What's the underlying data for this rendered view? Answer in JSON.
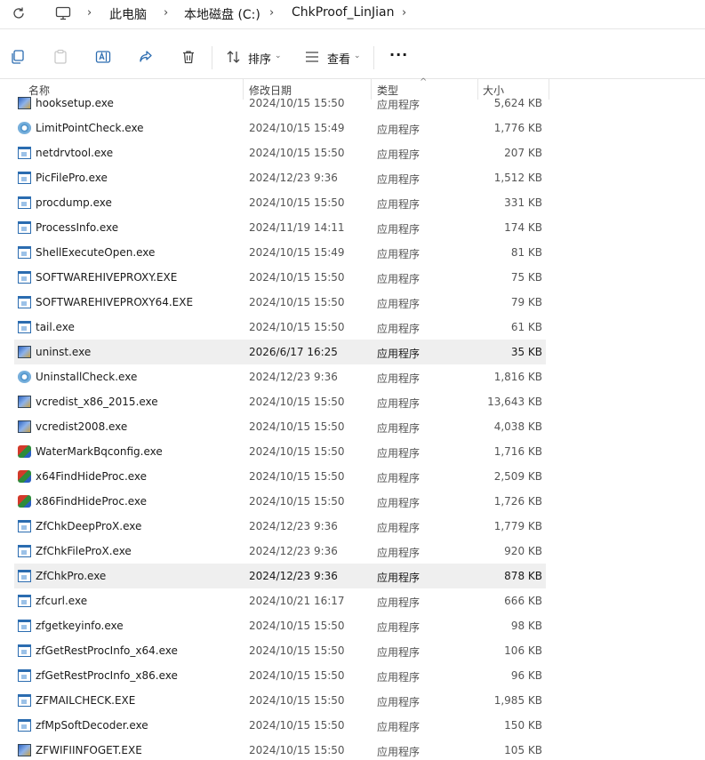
{
  "breadcrumb": {
    "items": [
      "此电脑",
      "本地磁盘 (C:)",
      "ChkProof_LinJian"
    ]
  },
  "toolbar": {
    "sort_label": "排序",
    "view_label": "查看",
    "more_label": "···"
  },
  "columns": {
    "name": "名称",
    "date": "修改日期",
    "type": "类型",
    "size": "大小"
  },
  "files": [
    {
      "name": "hooksetup.exe",
      "date": "2024/10/15 15:50",
      "type": "应用程序",
      "size": "5,624 KB",
      "icon": "installer-icon"
    },
    {
      "name": "LimitPointCheck.exe",
      "date": "2024/10/15 15:49",
      "type": "应用程序",
      "size": "1,776 KB",
      "icon": "disc-icon"
    },
    {
      "name": "netdrvtool.exe",
      "date": "2024/10/15 15:50",
      "type": "应用程序",
      "size": "207 KB",
      "icon": "app-window-icon"
    },
    {
      "name": "PicFilePro.exe",
      "date": "2024/12/23 9:36",
      "type": "应用程序",
      "size": "1,512 KB",
      "icon": "app-window-icon"
    },
    {
      "name": "procdump.exe",
      "date": "2024/10/15 15:50",
      "type": "应用程序",
      "size": "331 KB",
      "icon": "app-window-icon"
    },
    {
      "name": "ProcessInfo.exe",
      "date": "2024/11/19 14:11",
      "type": "应用程序",
      "size": "174 KB",
      "icon": "app-window-icon"
    },
    {
      "name": "ShellExecuteOpen.exe",
      "date": "2024/10/15 15:49",
      "type": "应用程序",
      "size": "81 KB",
      "icon": "app-window-icon"
    },
    {
      "name": "SOFTWAREHIVEPROXY.EXE",
      "date": "2024/10/15 15:50",
      "type": "应用程序",
      "size": "75 KB",
      "icon": "app-window-icon"
    },
    {
      "name": "SOFTWAREHIVEPROXY64.EXE",
      "date": "2024/10/15 15:50",
      "type": "应用程序",
      "size": "79 KB",
      "icon": "app-window-icon"
    },
    {
      "name": "tail.exe",
      "date": "2024/10/15 15:50",
      "type": "应用程序",
      "size": "61 KB",
      "icon": "app-window-icon"
    },
    {
      "name": "uninst.exe",
      "date": "2026/6/17 16:25",
      "type": "应用程序",
      "size": "35 KB",
      "icon": "installer-icon",
      "highlighted": true
    },
    {
      "name": "UninstallCheck.exe",
      "date": "2024/12/23 9:36",
      "type": "应用程序",
      "size": "1,816 KB",
      "icon": "disc-icon"
    },
    {
      "name": "vcredist_x86_2015.exe",
      "date": "2024/10/15 15:50",
      "type": "应用程序",
      "size": "13,643 KB",
      "icon": "installer-icon"
    },
    {
      "name": "vcredist2008.exe",
      "date": "2024/10/15 15:50",
      "type": "应用程序",
      "size": "4,038 KB",
      "icon": "installer-icon"
    },
    {
      "name": "WaterMarkBqconfig.exe",
      "date": "2024/10/15 15:50",
      "type": "应用程序",
      "size": "1,716 KB",
      "icon": "puzzle-icon"
    },
    {
      "name": "x64FindHideProc.exe",
      "date": "2024/10/15 15:50",
      "type": "应用程序",
      "size": "2,509 KB",
      "icon": "puzzle-icon"
    },
    {
      "name": "x86FindHideProc.exe",
      "date": "2024/10/15 15:50",
      "type": "应用程序",
      "size": "1,726 KB",
      "icon": "puzzle-icon"
    },
    {
      "name": "ZfChkDeepProX.exe",
      "date": "2024/12/23 9:36",
      "type": "应用程序",
      "size": "1,779 KB",
      "icon": "app-window-icon"
    },
    {
      "name": "ZfChkFileProX.exe",
      "date": "2024/12/23 9:36",
      "type": "应用程序",
      "size": "920 KB",
      "icon": "app-window-icon"
    },
    {
      "name": "ZfChkPro.exe",
      "date": "2024/12/23 9:36",
      "type": "应用程序",
      "size": "878 KB",
      "icon": "app-window-icon",
      "highlighted": true
    },
    {
      "name": "zfcurl.exe",
      "date": "2024/10/21 16:17",
      "type": "应用程序",
      "size": "666 KB",
      "icon": "app-window-icon"
    },
    {
      "name": "zfgetkeyinfo.exe",
      "date": "2024/10/15 15:50",
      "type": "应用程序",
      "size": "98 KB",
      "icon": "app-window-icon"
    },
    {
      "name": "zfGetRestProcInfo_x64.exe",
      "date": "2024/10/15 15:50",
      "type": "应用程序",
      "size": "106 KB",
      "icon": "app-window-icon"
    },
    {
      "name": "zfGetRestProcInfo_x86.exe",
      "date": "2024/10/15 15:50",
      "type": "应用程序",
      "size": "96 KB",
      "icon": "app-window-icon"
    },
    {
      "name": "ZFMAILCHECK.EXE",
      "date": "2024/10/15 15:50",
      "type": "应用程序",
      "size": "1,985 KB",
      "icon": "app-window-icon"
    },
    {
      "name": "zfMpSoftDecoder.exe",
      "date": "2024/10/15 15:50",
      "type": "应用程序",
      "size": "150 KB",
      "icon": "app-window-icon"
    },
    {
      "name": "ZFWIFIINFOGET.EXE",
      "date": "2024/10/15 15:50",
      "type": "应用程序",
      "size": "105 KB",
      "icon": "installer-icon"
    }
  ]
}
